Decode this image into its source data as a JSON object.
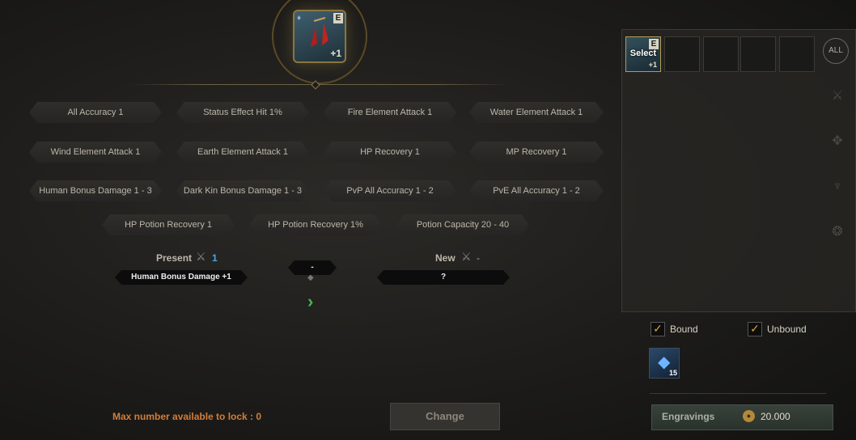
{
  "item": {
    "grade": "E",
    "enhance": "+1"
  },
  "options": [
    [
      "All Accuracy 1",
      "Status Effect Hit 1%",
      "Fire Element Attack 1",
      "Water Element Attack 1"
    ],
    [
      "Wind Element Attack 1",
      "Earth Element Attack 1",
      "HP Recovery 1",
      "MP Recovery 1"
    ],
    [
      "Human Bonus Damage 1 - 3",
      "Dark Kin Bonus Damage 1 - 3",
      "PvP All Accuracy 1 - 2",
      "PvE All Accuracy 1 - 2"
    ],
    [
      "HP Potion Recovery 1",
      "HP Potion Recovery 1%",
      "Potion Capacity 20 - 40"
    ]
  ],
  "present": {
    "label": "Present",
    "count": "1",
    "option": "Human Bonus Damage +1"
  },
  "middle": {
    "value": "-"
  },
  "new": {
    "label": "New",
    "count": "-",
    "option": "?"
  },
  "panel": {
    "select_label": "Select",
    "slot_item": {
      "grade": "E",
      "enhance": "+1"
    },
    "filter_all": "ALL",
    "bound_label": "Bound",
    "unbound_label": "Unbound",
    "material_qty": "15"
  },
  "footer": {
    "max_lock": "Max number available to lock : 0",
    "change_label": "Change",
    "engravings_label": "Engravings",
    "engravings_value": "20.000"
  }
}
